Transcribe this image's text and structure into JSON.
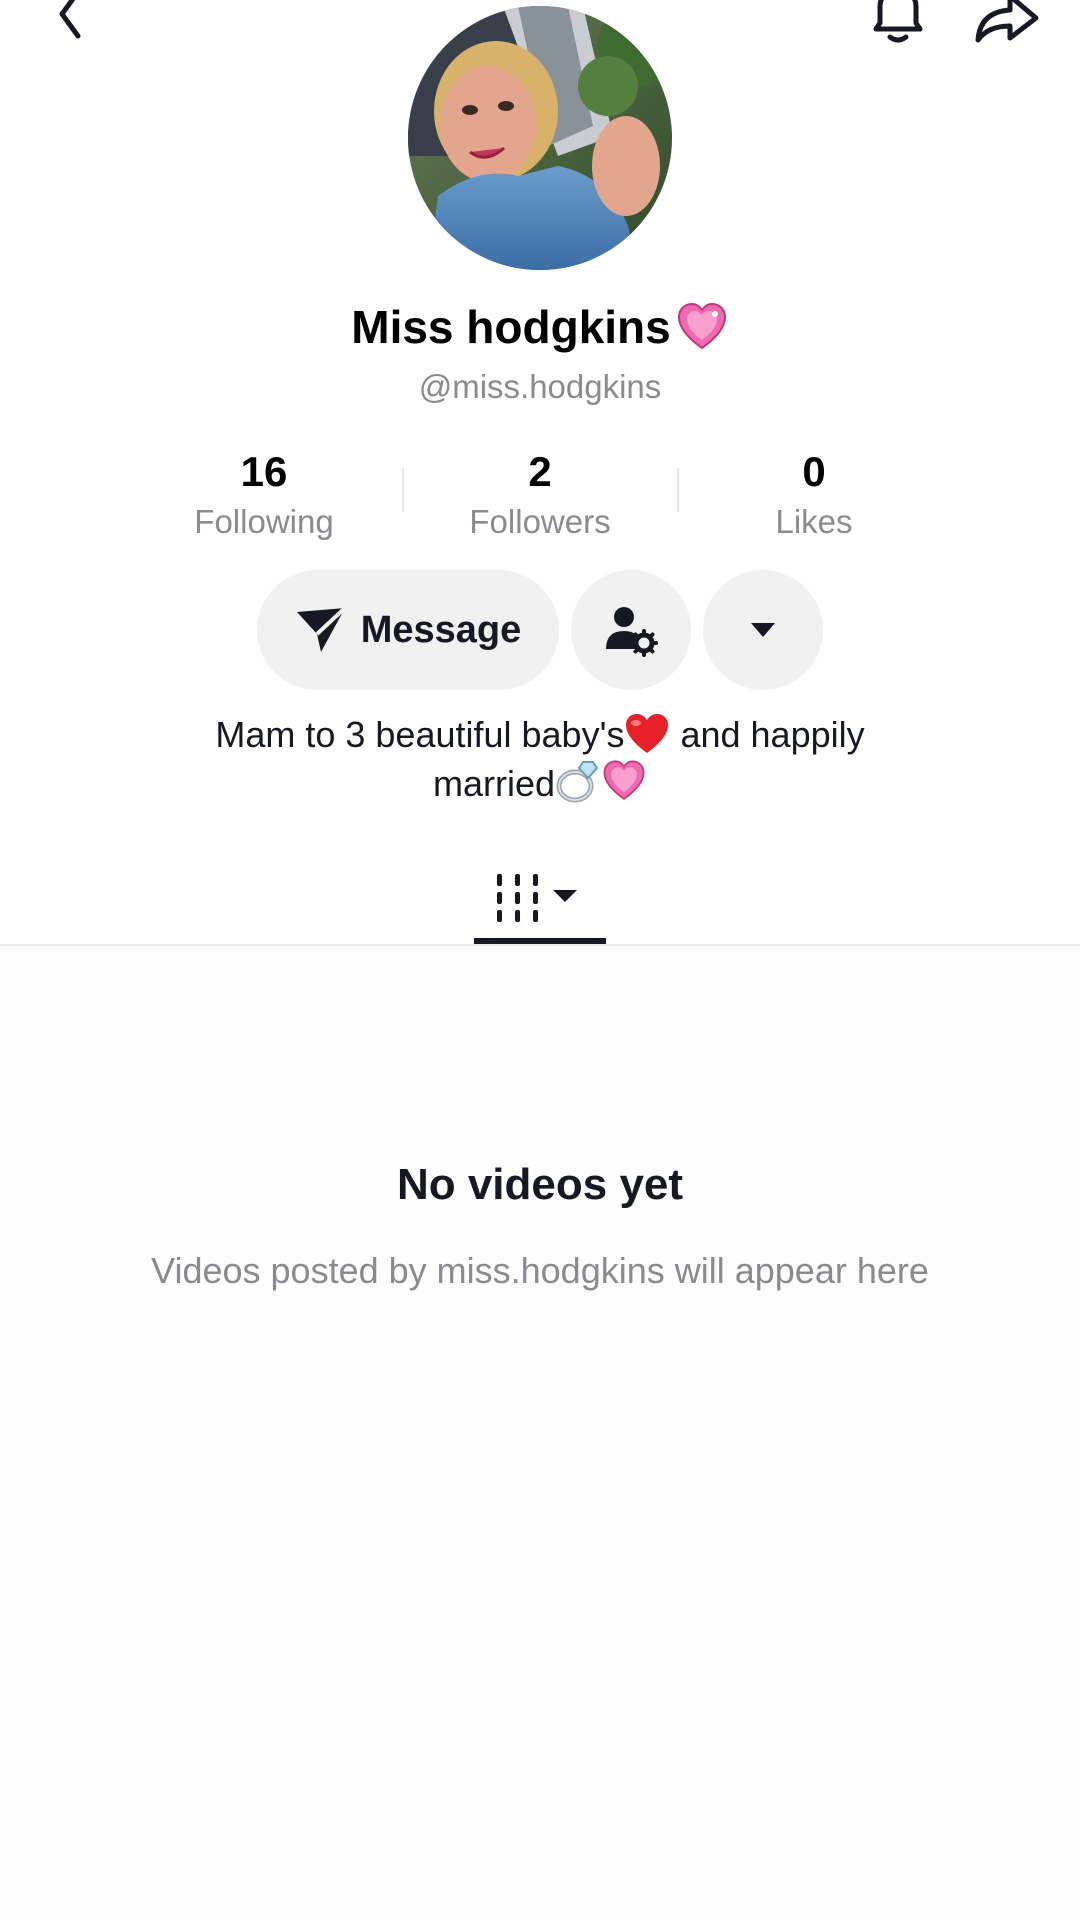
{
  "profile": {
    "display_name": "Miss hodgkins",
    "display_name_emoji": "heart-pink-sparkle",
    "username": "@miss.hodgkins"
  },
  "stats": {
    "following": {
      "count": "16",
      "label": "Following"
    },
    "followers": {
      "count": "2",
      "label": "Followers"
    },
    "likes": {
      "count": "0",
      "label": "Likes"
    }
  },
  "actions": {
    "message_label": "Message"
  },
  "bio": {
    "line1": "Mam to 3 beautiful baby's",
    "line1_end": " and happily",
    "line2": "married"
  },
  "tabs": {
    "videos_icon": "grid-icon"
  },
  "empty_state": {
    "title": "No videos yet",
    "subtitle": "Videos posted by miss.hodgkins will appear here"
  },
  "colors": {
    "accent_text": "#161823",
    "secondary_text": "#8a8b91",
    "button_bg": "#f1f1f2",
    "pink_heart": "#f06ab0",
    "red_heart": "#e8202a"
  }
}
